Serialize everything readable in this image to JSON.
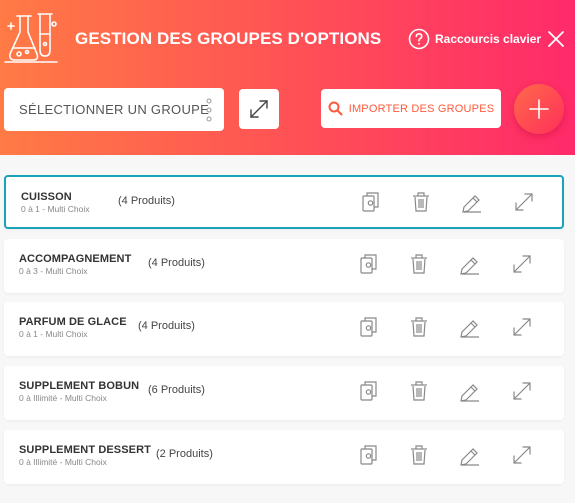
{
  "header": {
    "title": "GESTION DES GROUPES D'OPTIONS",
    "shortcuts_label": "Raccourcis clavier",
    "select_placeholder": "SÉLECTIONNER UN GROUPE",
    "import_label": "IMPORTER DES GROUPES"
  },
  "colors": {
    "gradient_start": "#ff7a45",
    "gradient_end": "#ff2a6a",
    "accent": "#ff5a3c",
    "selected_border": "#1aa3b8"
  },
  "icons": {
    "logo": "lab-flasks-icon",
    "shortcuts": "question-circle-icon",
    "close": "close-icon",
    "expand": "expand-arrows-icon",
    "search": "search-icon",
    "add": "plus-icon",
    "duplicate": "copy-icon",
    "delete": "trash-icon",
    "edit": "pencil-icon",
    "open": "expand-arrows-icon"
  },
  "groups": [
    {
      "name": "CUISSON",
      "sub": "0 à 1 - Multi Choix",
      "count": "(4 Produits)",
      "selected": true
    },
    {
      "name": "ACCOMPAGNEMENT",
      "sub": "0 à 3 - Multi Choix",
      "count": "(4 Produits)",
      "selected": false
    },
    {
      "name": "PARFUM DE GLACE",
      "sub": "0 à 1 - Multi Choix",
      "count": "(4 Produits)",
      "selected": false
    },
    {
      "name": "SUPPLEMENT BOBUN",
      "sub": "0 à Illimité - Multi Choix",
      "count": "(6 Produits)",
      "selected": false
    },
    {
      "name": "SUPPLEMENT DESSERT",
      "sub": "0 à Illimité - Multi Choix",
      "count": "(2 Produits)",
      "selected": false
    }
  ]
}
